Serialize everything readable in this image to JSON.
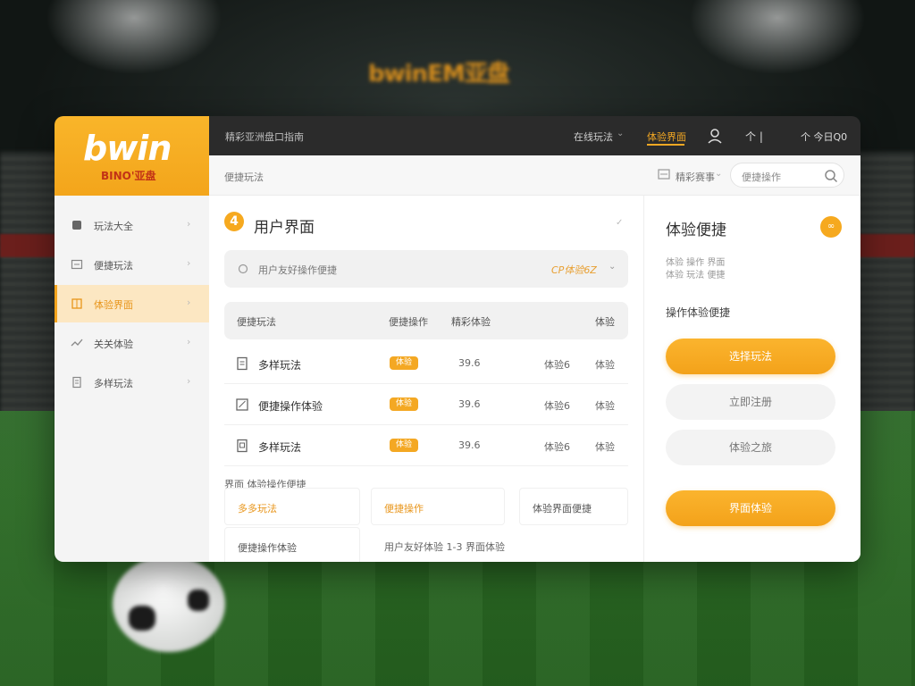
{
  "background": {
    "logo_main": "bwin",
    "logo_suffix": "EM亚盘"
  },
  "brand": {
    "word": "bwin",
    "sub": "BINO'亚盘",
    "color": "#f6a91f"
  },
  "topbar": {
    "title": "精彩亚洲盘口指南",
    "menu1": "在线玩法",
    "menu2": "体验界面",
    "signal": "个 |",
    "time": "个 今日Q0"
  },
  "sidebar": {
    "items": [
      {
        "label": "玩法大全",
        "icon": "home-icon",
        "active": false
      },
      {
        "label": "便捷玩法",
        "icon": "list-icon",
        "active": false
      },
      {
        "label": "体验界面",
        "icon": "grid-icon",
        "active": true
      },
      {
        "label": "关关体验",
        "icon": "chart-icon",
        "active": false
      },
      {
        "label": "多样玩法",
        "icon": "doc-icon",
        "active": false
      }
    ]
  },
  "subbar": {
    "label": "便捷玩法",
    "filter": "精彩赛事",
    "search_placeholder": "便捷操作"
  },
  "panel": {
    "number": "4",
    "title": "用户界面",
    "filter_text": "用户友好操作便捷",
    "filter_value": "CP体验6Z",
    "columns": [
      "便捷玩法",
      "便捷操作",
      "精彩体验",
      "体验"
    ],
    "rows": [
      {
        "name": "多样玩法",
        "badge": "体验",
        "num": "39.6",
        "num2": "体验6",
        "end": "体验"
      },
      {
        "name": "便捷操作体验",
        "badge": "体验",
        "num": "39.6",
        "num2": "体验6",
        "end": "体验"
      },
      {
        "name": "多样玩法",
        "badge": "体验",
        "num": "39.6",
        "num2": "体验6",
        "end": "体验"
      }
    ],
    "section_label": "界面 体验操作便捷",
    "cells": [
      "多多玩法",
      "便捷操作",
      "体验界面便捷"
    ],
    "cell_bottom": "便捷操作体验",
    "bottom_text": "用户友好体验 1-3 界面体验"
  },
  "right": {
    "title": "体验便捷",
    "dot": "∞",
    "meta1": "体验 操作 界面",
    "meta2": "体验 玩法 便捷",
    "subtitle": "操作体验便捷",
    "buttons": [
      {
        "label": "选择玩法",
        "type": "primary"
      },
      {
        "label": "立即注册",
        "type": "secondary"
      },
      {
        "label": "体验之旅",
        "type": "secondary"
      },
      {
        "label": "界面体验",
        "type": "primary"
      }
    ]
  }
}
